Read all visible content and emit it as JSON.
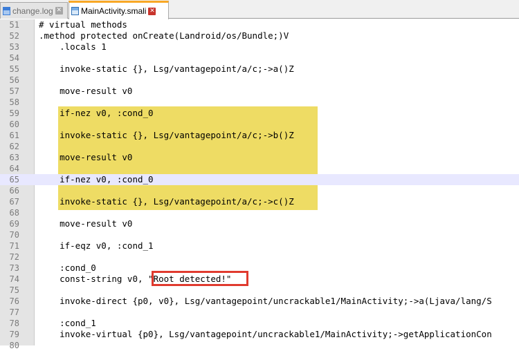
{
  "tabs": [
    {
      "label": "change.log",
      "active": false
    },
    {
      "label": "MainActivity.smali",
      "active": true
    }
  ],
  "editor": {
    "current_line": 65,
    "highlighted_lines": [
      59,
      67
    ],
    "boxed_text": "\"Root detected!\"",
    "lines": [
      {
        "n": "51",
        "text": "# virtual methods"
      },
      {
        "n": "52",
        "text": ".method protected onCreate(Landroid/os/Bundle;)V"
      },
      {
        "n": "53",
        "text": "    .locals 1"
      },
      {
        "n": "54",
        "text": ""
      },
      {
        "n": "55",
        "text": "    invoke-static {}, Lsg/vantagepoint/a/c;->a()Z"
      },
      {
        "n": "56",
        "text": ""
      },
      {
        "n": "57",
        "text": "    move-result v0"
      },
      {
        "n": "58",
        "text": ""
      },
      {
        "n": "59",
        "text": "    if-nez v0, :cond_0"
      },
      {
        "n": "60",
        "text": ""
      },
      {
        "n": "61",
        "text": "    invoke-static {}, Lsg/vantagepoint/a/c;->b()Z"
      },
      {
        "n": "62",
        "text": ""
      },
      {
        "n": "63",
        "text": "    move-result v0"
      },
      {
        "n": "64",
        "text": ""
      },
      {
        "n": "65",
        "text": "    if-nez v0, :cond_0"
      },
      {
        "n": "66",
        "text": ""
      },
      {
        "n": "67",
        "text": "    invoke-static {}, Lsg/vantagepoint/a/c;->c()Z"
      },
      {
        "n": "68",
        "text": ""
      },
      {
        "n": "69",
        "text": "    move-result v0"
      },
      {
        "n": "70",
        "text": ""
      },
      {
        "n": "71",
        "text": "    if-eqz v0, :cond_1"
      },
      {
        "n": "72",
        "text": ""
      },
      {
        "n": "73",
        "text": "    :cond_0"
      },
      {
        "n": "74",
        "text": "    const-string v0, \"Root detected!\""
      },
      {
        "n": "75",
        "text": ""
      },
      {
        "n": "76",
        "text": "    invoke-direct {p0, v0}, Lsg/vantagepoint/uncrackable1/MainActivity;->a(Ljava/lang/S"
      },
      {
        "n": "77",
        "text": ""
      },
      {
        "n": "78",
        "text": "    :cond_1"
      },
      {
        "n": "79",
        "text": "    invoke-virtual {p0}, Lsg/vantagepoint/uncrackable1/MainActivity;->getApplicationCon"
      },
      {
        "n": "80",
        "text": ""
      }
    ]
  }
}
